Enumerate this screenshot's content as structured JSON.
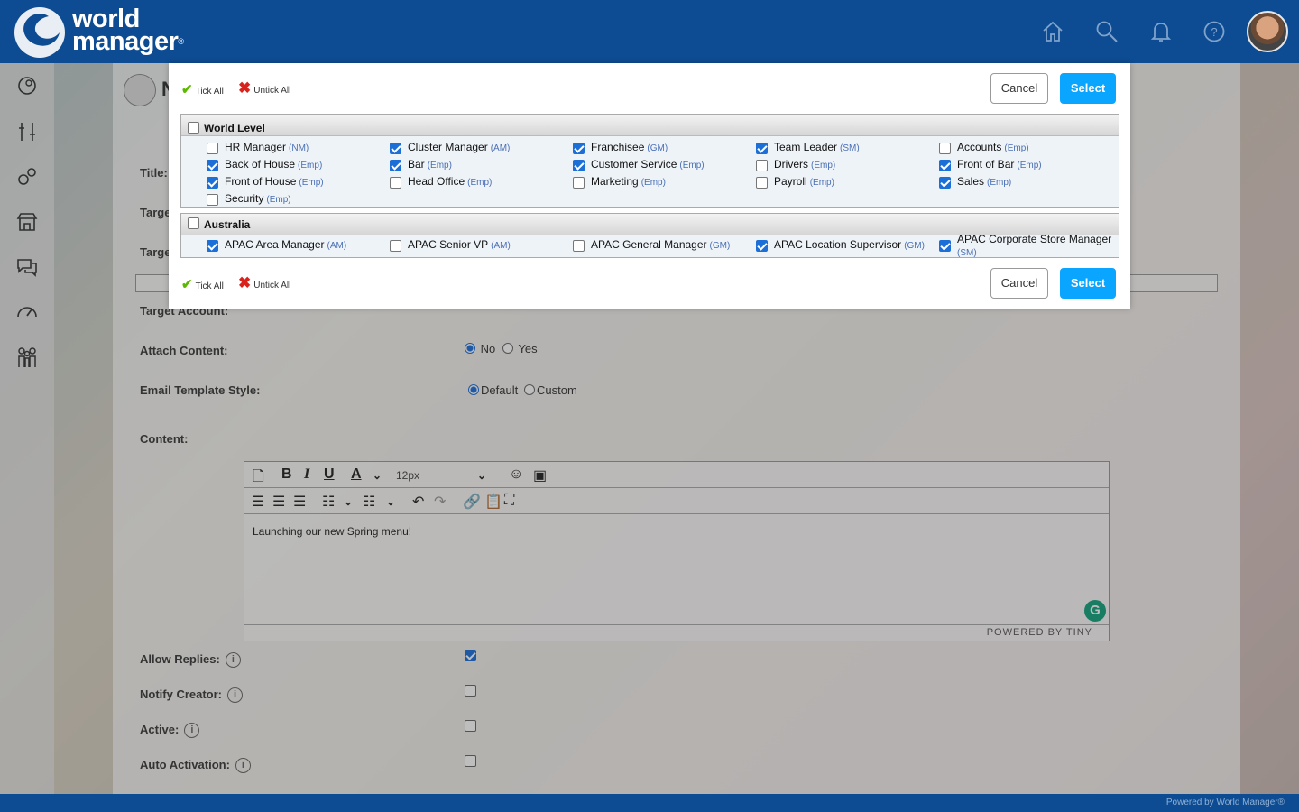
{
  "header": {
    "logo_line1": "world",
    "logo_line2": "manager",
    "logo_mark": "®",
    "icons": [
      "home-icon",
      "search-icon",
      "bell-icon",
      "help-icon"
    ]
  },
  "sidebar": {
    "icons": [
      "pin-icon",
      "tools-icon",
      "gears-icon",
      "store-icon",
      "chat-icon",
      "dashboard-icon",
      "people-icon"
    ],
    "collapse_label": "»"
  },
  "form": {
    "title_label": "Title:",
    "target_label_1": "Targe",
    "target_label_2": "Targe",
    "target_account_label": "Target Account:",
    "attach_content_label": "Attach Content:",
    "attach_no": "No",
    "attach_yes": "Yes",
    "attach_value": "No",
    "email_style_label": "Email Template Style:",
    "style_default": "Default",
    "style_custom": "Custom",
    "style_value": "Default",
    "content_label": "Content:",
    "allow_replies_label": "Allow Replies:",
    "allow_replies": true,
    "notify_creator_label": "Notify Creator:",
    "notify_creator": false,
    "active_label": "Active:",
    "active": false,
    "auto_activation_label": "Auto Activation:",
    "auto_activation": false
  },
  "editor": {
    "font_size": "12px",
    "content": "Launching our new Spring menu!",
    "powered": "POWERED BY TINY"
  },
  "modal": {
    "tick_all": "Tick All",
    "untick_all": "Untick All",
    "cancel": "Cancel",
    "select": "Select",
    "groups": [
      {
        "title": "World Level",
        "checked": false,
        "items": [
          {
            "name": "HR Manager",
            "role": "(NM)",
            "checked": false
          },
          {
            "name": "Cluster Manager",
            "role": "(AM)",
            "checked": true
          },
          {
            "name": "Franchisee",
            "role": "(GM)",
            "checked": true
          },
          {
            "name": "Team Leader",
            "role": "(SM)",
            "checked": true
          },
          {
            "name": "Accounts",
            "role": "(Emp)",
            "checked": false
          },
          {
            "name": "Back of House",
            "role": "(Emp)",
            "checked": true
          },
          {
            "name": "Bar",
            "role": "(Emp)",
            "checked": true
          },
          {
            "name": "Customer Service",
            "role": "(Emp)",
            "checked": true
          },
          {
            "name": "Drivers",
            "role": "(Emp)",
            "checked": false
          },
          {
            "name": "Front of Bar",
            "role": "(Emp)",
            "checked": true
          },
          {
            "name": "Front of House",
            "role": "(Emp)",
            "checked": true
          },
          {
            "name": "Head Office",
            "role": "(Emp)",
            "checked": false
          },
          {
            "name": "Marketing",
            "role": "(Emp)",
            "checked": false
          },
          {
            "name": "Payroll",
            "role": "(Emp)",
            "checked": false
          },
          {
            "name": "Sales",
            "role": "(Emp)",
            "checked": true
          },
          {
            "name": "Security",
            "role": "(Emp)",
            "checked": false
          }
        ]
      },
      {
        "title": "Australia",
        "checked": false,
        "items": [
          {
            "name": "APAC Area Manager",
            "role": "(AM)",
            "checked": true
          },
          {
            "name": "APAC Senior VP",
            "role": "(AM)",
            "checked": false
          },
          {
            "name": "APAC General Manager",
            "role": "(GM)",
            "checked": false
          },
          {
            "name": "APAC Location Supervisor",
            "role": "(GM)",
            "checked": true
          },
          {
            "name": "APAC Corporate Store Manager",
            "role": "(SM)",
            "checked": true
          }
        ]
      }
    ]
  },
  "footer": {
    "powered_by": "Powered by World Manager®"
  },
  "colors": {
    "brand": "#0d4c92",
    "select_button": "#0aa5ff",
    "checkbox": "#1d6fd8",
    "role_tag": "#4a6fb5"
  }
}
